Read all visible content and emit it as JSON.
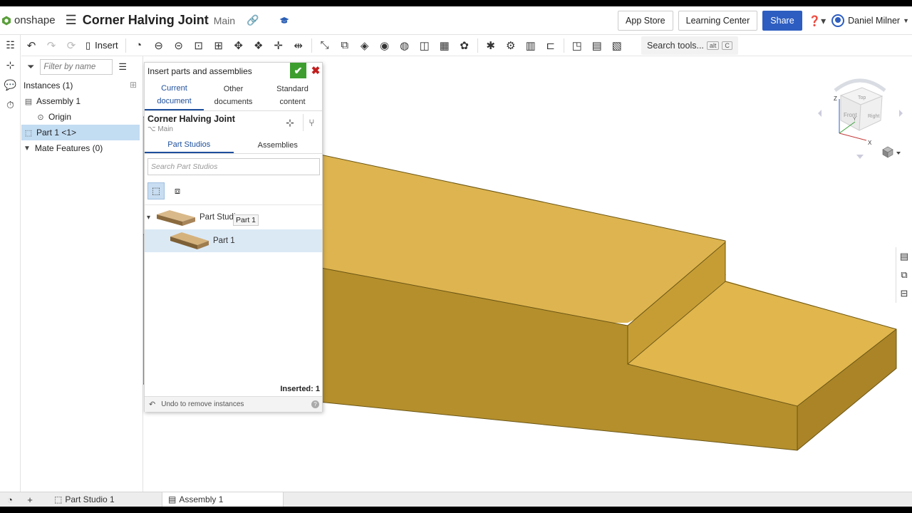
{
  "header": {
    "logo": "onshape",
    "menu_icon": "hamburger-icon",
    "doc_title": "Corner Halving Joint",
    "branch": "Main",
    "link_icon": "link-icon",
    "learn_icon": "graduation-cap-icon",
    "app_store": "App Store",
    "learning_center": "Learning Center",
    "share": "Share",
    "help_icon": "question-icon",
    "user": "Daniel Milner"
  },
  "toolbar": {
    "insert": "Insert",
    "search_tools": "Search tools...",
    "shortcut_alt": "alt",
    "shortcut_key": "C"
  },
  "instances": {
    "filter_placeholder": "Filter by name",
    "header": "Instances (1)",
    "assembly": "Assembly 1",
    "origin": "Origin",
    "part": "Part 1 <1>",
    "mate_features": "Mate Features (0)"
  },
  "dialog": {
    "title": "Insert parts and assemblies",
    "tabs": [
      {
        "line1": "Current",
        "line2": "document"
      },
      {
        "line1": "Other",
        "line2": "documents"
      },
      {
        "line1": "Standard",
        "line2": "content"
      }
    ],
    "doc_name": "Corner Halving Joint",
    "doc_branch": "Main",
    "sub_tabs": [
      "Part Studios",
      "Assemblies"
    ],
    "search_placeholder": "Search Part Studios",
    "part_studio_label": "Part Studi",
    "tooltip": "Part 1",
    "part_label": "Part 1",
    "inserted": "Inserted: 1",
    "undo": "Undo to remove instances"
  },
  "navcube": {
    "top": "Top",
    "front": "Front",
    "right": "Right",
    "axis_x": "X",
    "axis_y": "Y",
    "axis_z": "Z"
  },
  "bottom_tabs": {
    "part_studio": "Part Studio 1",
    "assembly": "Assembly 1"
  },
  "colors": {
    "accent": "#2d5dc0",
    "part_fill": "#e0b64d",
    "ok_green": "#3d9e2f",
    "close_red": "#c21d1d",
    "selection": "#c2dcf2"
  }
}
